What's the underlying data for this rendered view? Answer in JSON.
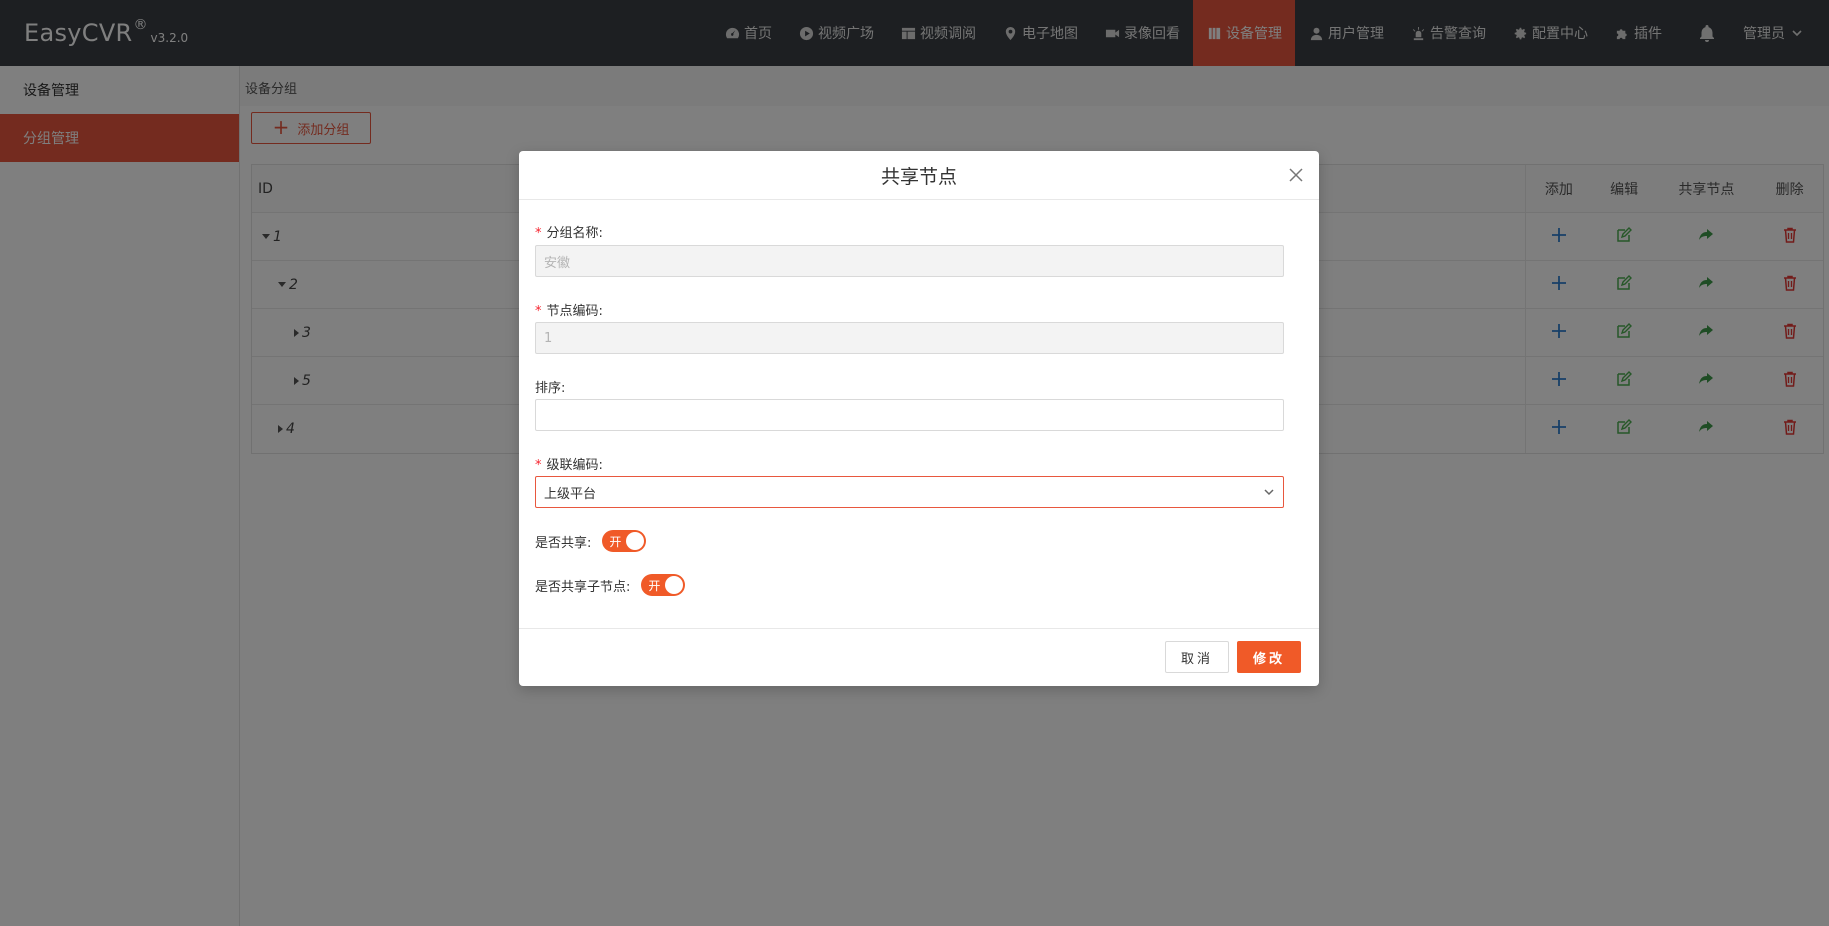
{
  "brand": {
    "name": "EasyCVR",
    "reg": "®",
    "version": "v3.2.0"
  },
  "nav": [
    {
      "label": "首页",
      "icon": "dashboard-icon"
    },
    {
      "label": "视频广场",
      "icon": "play-icon"
    },
    {
      "label": "视频调阅",
      "icon": "layout-icon"
    },
    {
      "label": "电子地图",
      "icon": "map-pin-icon"
    },
    {
      "label": "录像回看",
      "icon": "video-camera-icon"
    },
    {
      "label": "设备管理",
      "icon": "device-icon",
      "active": true
    },
    {
      "label": "用户管理",
      "icon": "user-icon"
    },
    {
      "label": "告警查询",
      "icon": "alarm-icon"
    },
    {
      "label": "配置中心",
      "icon": "gear-icon"
    },
    {
      "label": "插件",
      "icon": "puzzle-icon"
    }
  ],
  "user": {
    "label": "管理员"
  },
  "sidebar": {
    "items": [
      {
        "label": "设备管理"
      },
      {
        "label": "分组管理",
        "active": true
      }
    ]
  },
  "main": {
    "breadcrumb": "设备分组",
    "add_group_label": "添加分组",
    "table": {
      "headers": {
        "id": "ID",
        "add": "添加",
        "edit": "编辑",
        "share": "共享节点",
        "delete": "删除"
      },
      "rows": [
        {
          "id": "1",
          "indent": 0,
          "caret": "down"
        },
        {
          "id": "2",
          "indent": 1,
          "caret": "down"
        },
        {
          "id": "3",
          "indent": 2,
          "caret": "right"
        },
        {
          "id": "5",
          "indent": 2,
          "caret": "right"
        },
        {
          "id": "4",
          "indent": 1,
          "caret": "right"
        }
      ]
    }
  },
  "colors": {
    "accent": "#e8573e",
    "switch_on": "#f05a28",
    "add_icon": "#2f7fd1",
    "edit_icon": "#4caf50",
    "share_icon": "#3f9a4a",
    "delete_icon": "#e53935"
  },
  "modal": {
    "title": "共享节点",
    "fields": {
      "group_name": {
        "label": "分组名称:",
        "value": "安徽"
      },
      "node_code": {
        "label": "节点编码:",
        "value": "1"
      },
      "sort": {
        "label": "排序:",
        "value": ""
      },
      "cascade_code": {
        "label": "级联编码:",
        "value": "上级平台"
      }
    },
    "switches": {
      "shared": {
        "label": "是否共享:",
        "state": "开"
      },
      "share_children": {
        "label": "是否共享子节点:",
        "state": "开"
      }
    },
    "cancel_label": "取消",
    "ok_label": "修改"
  }
}
